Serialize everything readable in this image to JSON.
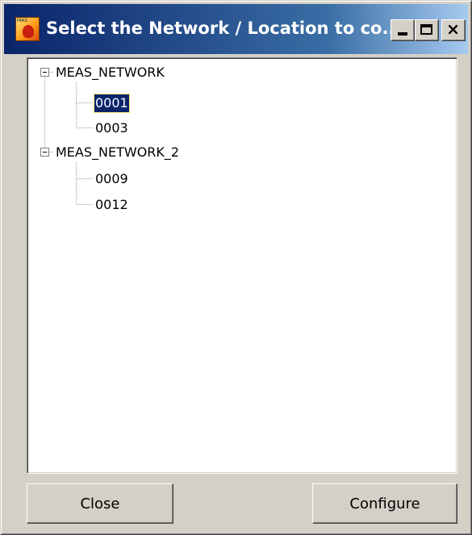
{
  "window": {
    "title": "Select the Network / Location to co...",
    "icon": "app-icon",
    "title_colors": {
      "start": "#0a246a",
      "end": "#a6caf0"
    }
  },
  "tree": {
    "nodes": [
      {
        "label": "MEAS_NETWORK",
        "expanded": true,
        "children": [
          {
            "label": "0001",
            "selected": true
          },
          {
            "label": "0003",
            "selected": false
          }
        ]
      },
      {
        "label": "MEAS_NETWORK_2",
        "expanded": true,
        "children": [
          {
            "label": "0009",
            "selected": false
          },
          {
            "label": "0012",
            "selected": false
          }
        ]
      }
    ]
  },
  "buttons": {
    "close_label": "Close",
    "configure_label": "Configure"
  },
  "colors": {
    "selection": "#0a246a",
    "dialog_bg": "#d4d0c8"
  }
}
